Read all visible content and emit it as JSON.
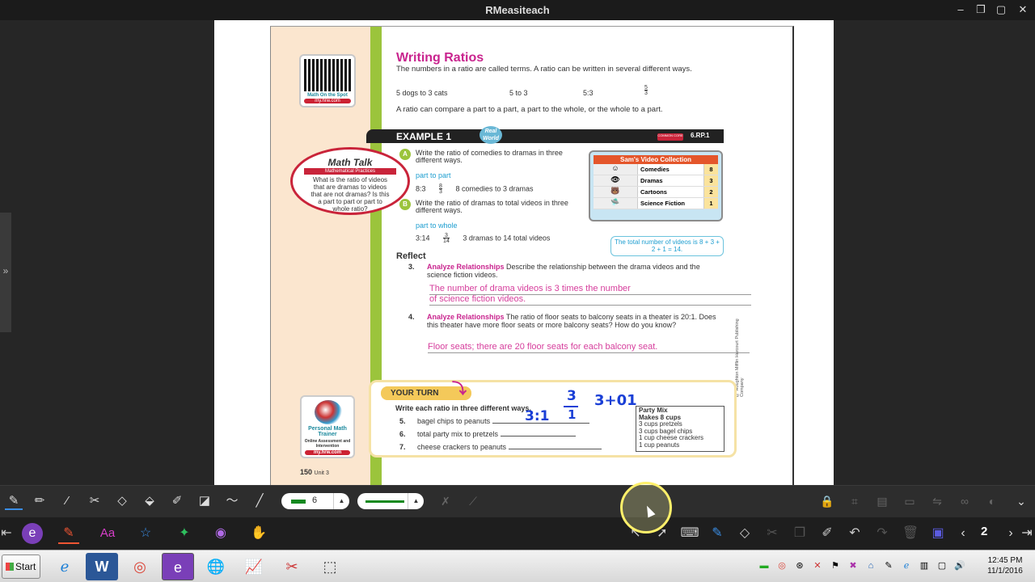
{
  "app": {
    "title": "RMeasiteach"
  },
  "window_controls": [
    "–",
    "❐",
    "▢",
    "✕"
  ],
  "book": {
    "qr_label": "Math On the Spot",
    "qr_url": "my.hrw.com",
    "heading": "Writing Ratios",
    "intro": "The numbers in a ratio are called terms. A ratio can be written in several different ways.",
    "examples": [
      "5 dogs to 3 cats",
      "5 to 3",
      "5:3"
    ],
    "fraction_example": {
      "num": "5",
      "den": "3"
    },
    "compare_text": "A ratio can compare a part to a part, a part to the whole, or the whole to a part.",
    "example_label": "EXAMPLE 1",
    "real_world": "Real World",
    "standard": "6.RP.1",
    "common_core": "COMMON CORE",
    "math_talk": {
      "title": "Math Talk",
      "subtitle": "Mathematical Practices",
      "body": "What is the ratio of videos that are dramas to videos that are not dramas? Is this a part to part or part to whole ratio?"
    },
    "step_a": {
      "letter": "A",
      "question": "Write the ratio of comedies to dramas in three different ways.",
      "tag": "part to part",
      "answer_colon": "8:3",
      "frac": {
        "num": "8",
        "den": "3"
      },
      "answer_words": "8 comedies to 3 dramas"
    },
    "step_b": {
      "letter": "B",
      "question": "Write the ratio of dramas to total videos in three different ways.",
      "tag": "part to whole",
      "answer_colon": "3:14",
      "frac": {
        "num": "3",
        "den": "14"
      },
      "answer_words": "3 dramas to 14 total videos"
    },
    "video_collection": {
      "title": "Sam's Video Collection",
      "rows": [
        {
          "icon": "☺",
          "name": "Comedies",
          "count": "8"
        },
        {
          "icon": "👁",
          "name": "Dramas",
          "count": "3"
        },
        {
          "icon": "🐻",
          "name": "Cartoons",
          "count": "2"
        },
        {
          "icon": "🛸",
          "name": "Science Fiction",
          "count": "1"
        }
      ]
    },
    "note": "The total number of videos is 8 + 3 + 2 + 1 = 14.",
    "reflect": "Reflect",
    "q3": {
      "num": "3.",
      "label": "Analyze Relationships",
      "text": "Describe the relationship between the drama videos and the science fiction videos.",
      "answer_line1": "The number of drama videos is 3 times the number",
      "answer_line2": "of science fiction videos."
    },
    "q4": {
      "num": "4.",
      "label": "Analyze Relationships",
      "text": "The ratio of floor seats to balcony seats in a theater is 20:1. Does this theater have more floor seats or more balcony seats? How do you know?",
      "answer": "Floor seats; there are 20 floor seats for each balcony seat."
    },
    "copyright": "© Houghton Mifflin Harcourt Publishing Company",
    "your_turn": {
      "badge": "YOUR TURN",
      "instruction": "Write each ratio in three different ways.",
      "items": [
        {
          "num": "5.",
          "text": "bagel chips to peanuts"
        },
        {
          "num": "6.",
          "text": "total party mix to pretzels"
        },
        {
          "num": "7.",
          "text": "cheese crackers to peanuts"
        }
      ],
      "party_mix": [
        "Party Mix",
        "Makes 8 cups",
        "3 cups pretzels",
        "3 cups bagel chips",
        "1 cup cheese crackers",
        "1 cup peanuts"
      ]
    },
    "handwriting": {
      "fraction_num": "3",
      "fraction_den": "1",
      "colon": "3:1",
      "sum": "3+01"
    },
    "personal_trainer": {
      "title": "Personal Math Trainer",
      "subtitle": "Online Assessment and Intervention",
      "url": "my.hrw.com"
    },
    "page_number": "150",
    "unit": "Unit 3"
  },
  "toolbar": {
    "pen_width": "6",
    "page_indicator": "2"
  },
  "taskbar": {
    "start": "Start",
    "time": "12:45 PM",
    "date": "11/1/2016"
  },
  "colors": {
    "pen": "#13891f",
    "handwriting": "#1a3fd6",
    "answer_pink": "#d63e9c",
    "heading": "#c9248e"
  }
}
